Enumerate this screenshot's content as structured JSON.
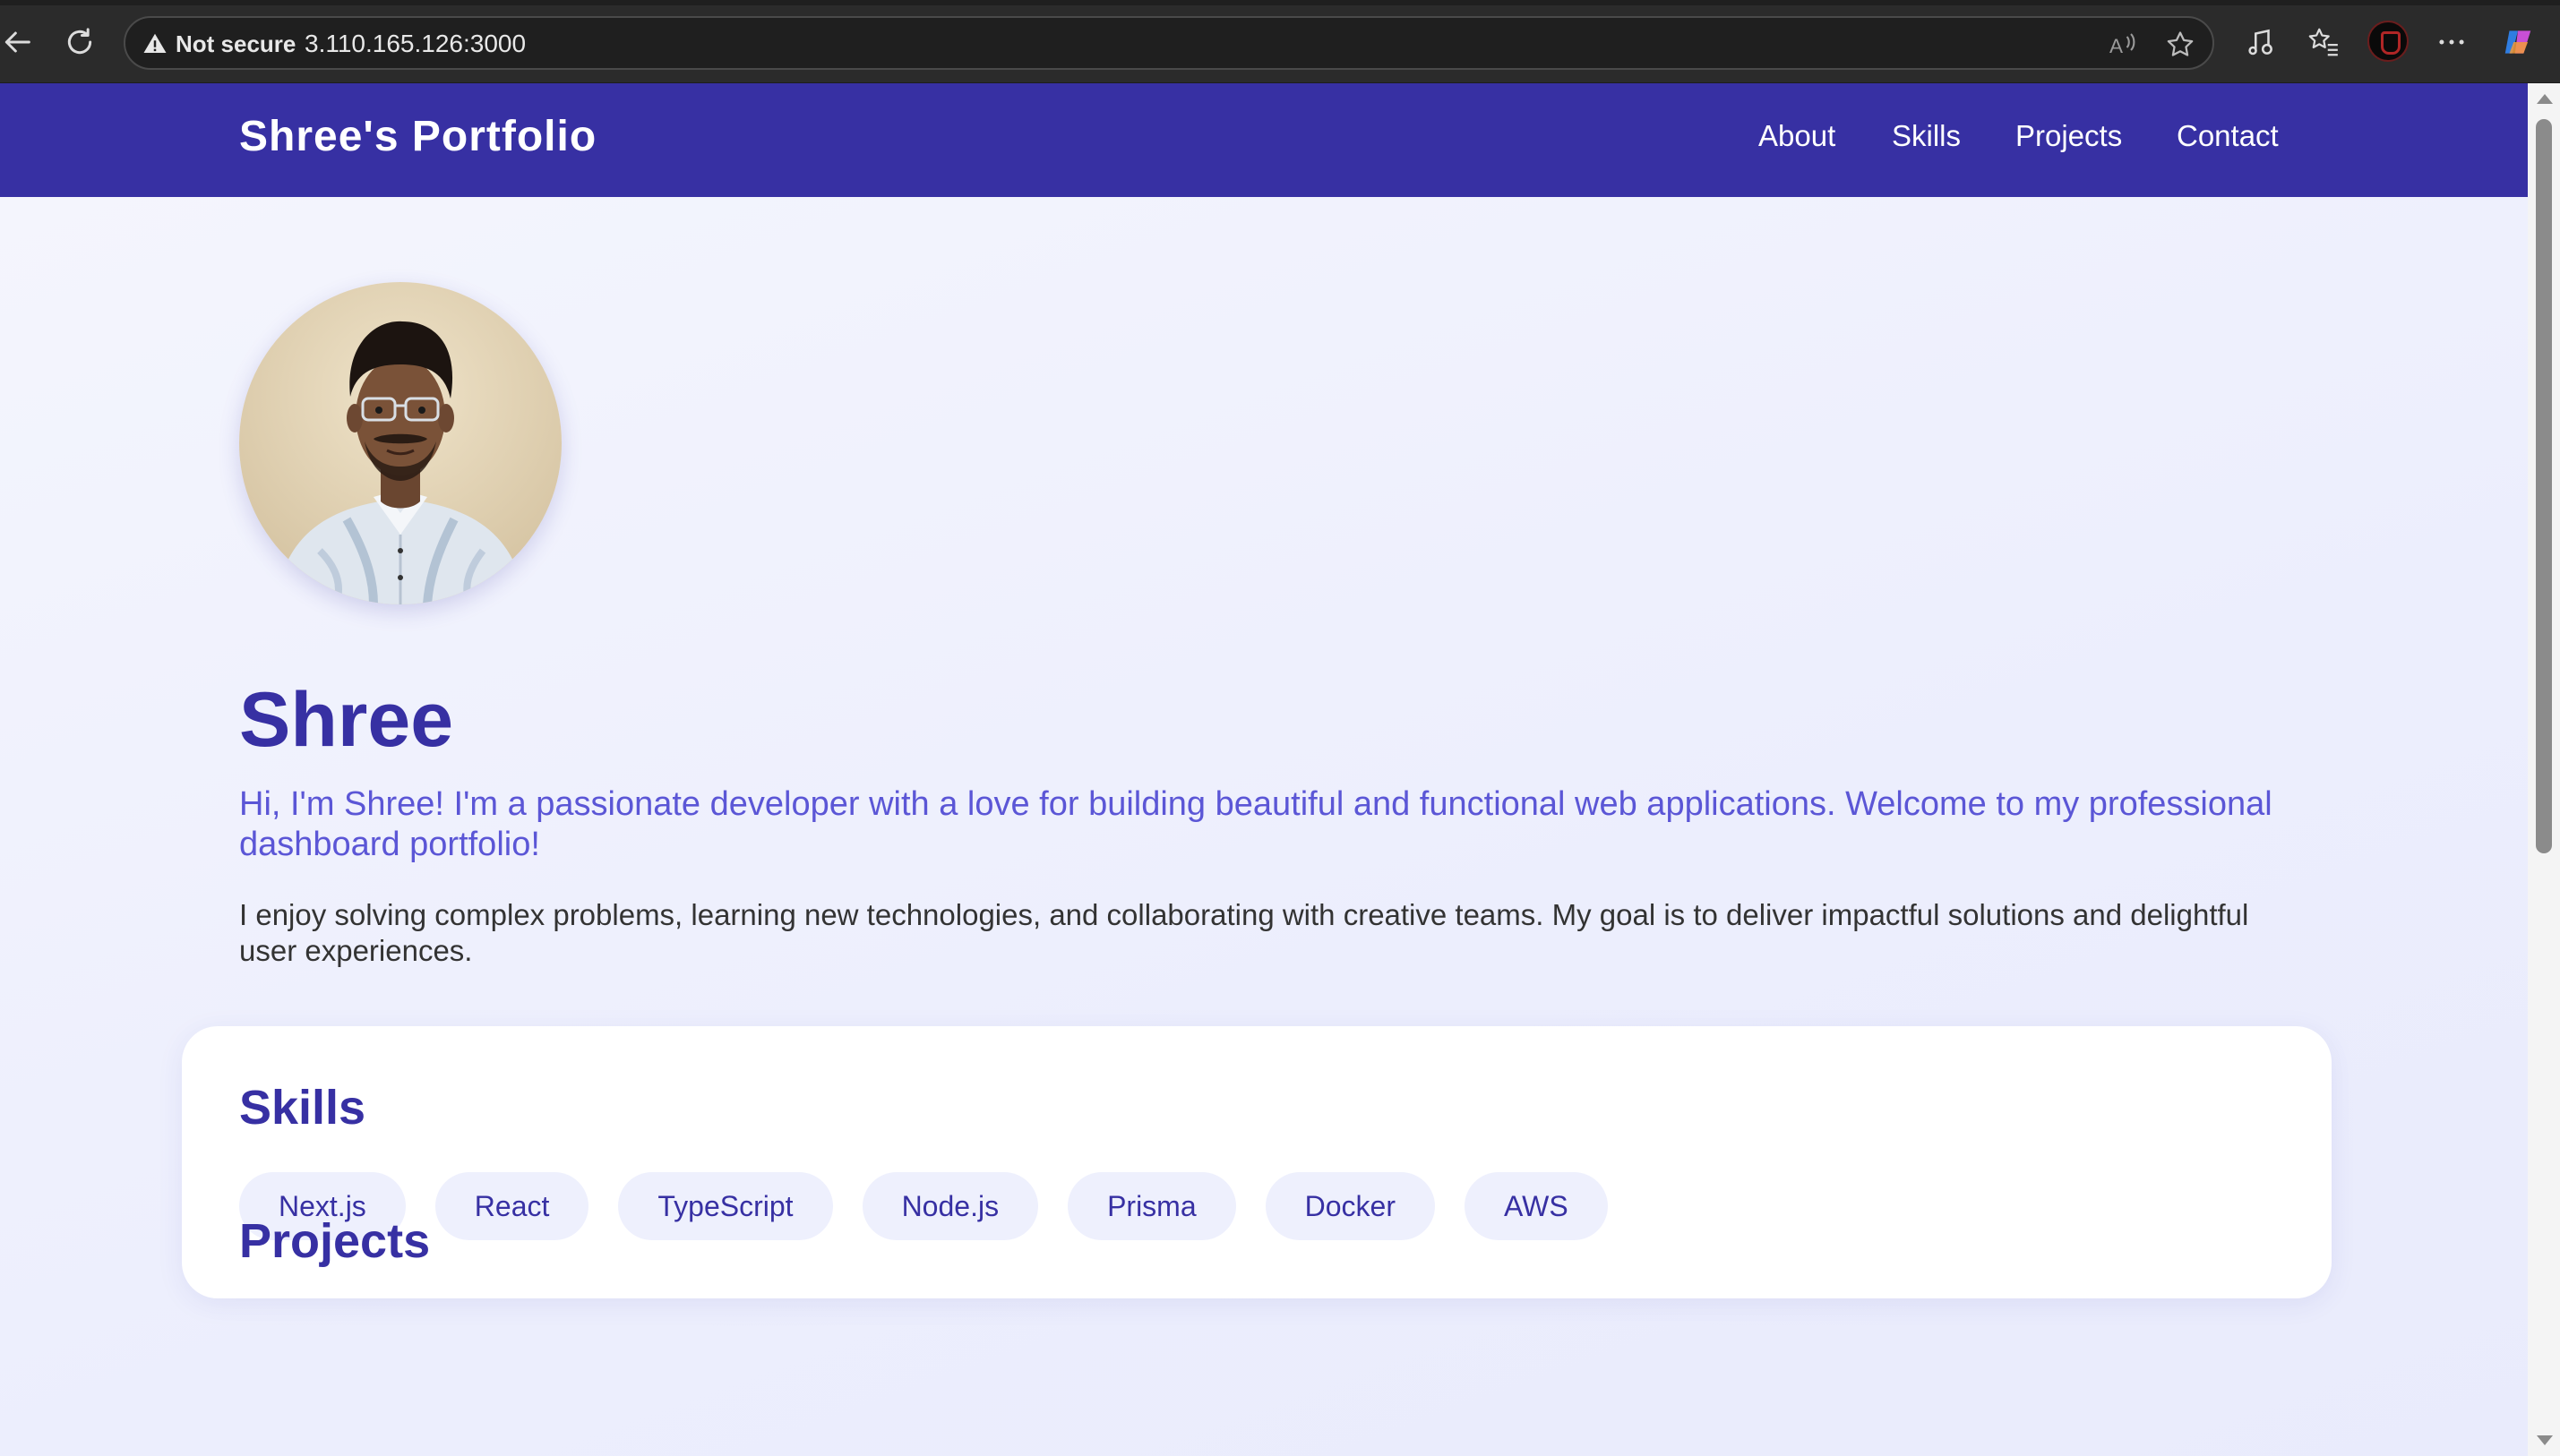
{
  "browser": {
    "security_label": "Not secure",
    "url": "3.110.165.126:3000"
  },
  "site": {
    "brand": "Shree's Portfolio",
    "nav": [
      "About",
      "Skills",
      "Projects",
      "Contact"
    ]
  },
  "hero": {
    "name": "Shree",
    "intro": "Hi, I'm Shree! I'm a passionate developer with a love for building beautiful and functional web applications. Welcome to my professional dashboard portfolio!",
    "about": "I enjoy solving complex problems, learning new technologies, and collaborating with creative teams. My goal is to deliver impactful solutions and delightful user experiences."
  },
  "skills": {
    "title": "Skills",
    "items": [
      "Next.js",
      "React",
      "TypeScript",
      "Node.js",
      "Prisma",
      "Docker",
      "AWS"
    ]
  },
  "projects": {
    "title": "Projects"
  },
  "colors": {
    "brand": "#3730a3",
    "intro_text": "#5b56d6",
    "chip_bg": "#eef0fd"
  }
}
